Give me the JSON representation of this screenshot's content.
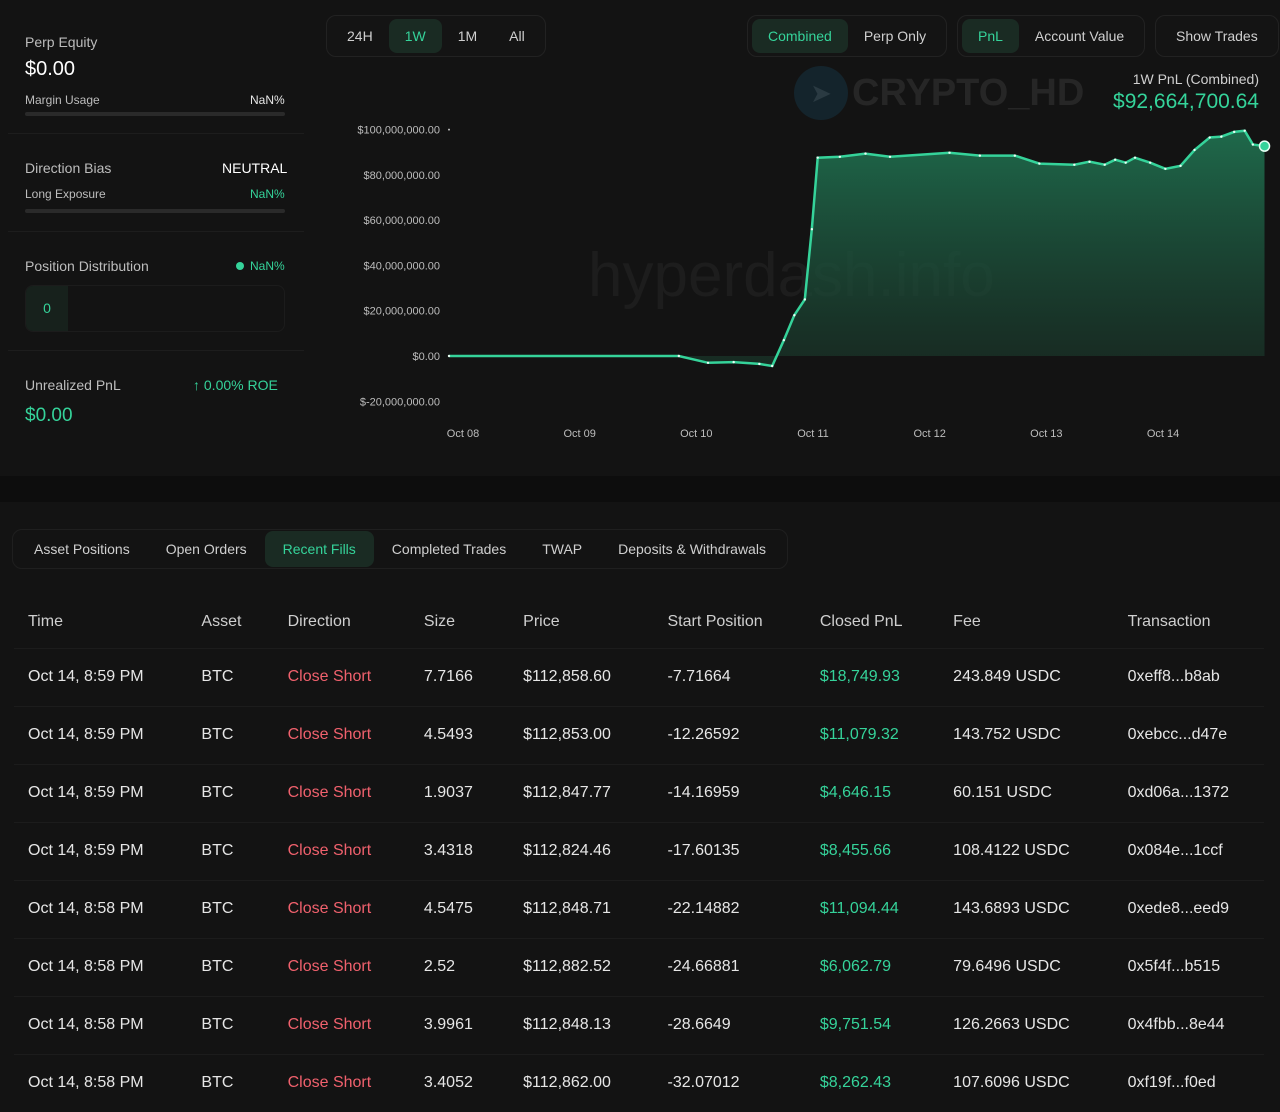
{
  "summary": {
    "perp_equity_label": "Perp Equity",
    "perp_equity": "$0.00",
    "margin_usage_label": "Margin Usage",
    "margin_usage": "NaN%",
    "direction_bias_label": "Direction Bias",
    "direction_bias": "NEUTRAL",
    "long_exposure_label": "Long Exposure",
    "long_exposure": "NaN%",
    "position_distribution_label": "Position Distribution",
    "position_distribution": "NaN%",
    "position_count": "0",
    "unrealized_pnl_label": "Unrealized PnL",
    "roe": "0.00% ROE",
    "unrealized_pnl": "$0.00"
  },
  "range_tabs": [
    "24H",
    "1W",
    "1M",
    "All"
  ],
  "mode_tabs": [
    "Combined",
    "Perp Only"
  ],
  "metric_tabs": [
    "PnL",
    "Account Value"
  ],
  "show_trades": "Show Trades",
  "watermark": "CRYPTO_HD",
  "watermark2": "hyperdash.info",
  "pnl_label": "1W PnL (Combined)",
  "pnl_value": "$92,664,700.64",
  "colors": {
    "accent": "#35d39a",
    "negative": "#f0616d"
  },
  "chart_data": {
    "type": "area",
    "yticks": [
      "$100,000,000.00",
      "$80,000,000.00",
      "$60,000,000.00",
      "$40,000,000.00",
      "$20,000,000.00",
      "$0.00",
      "$-20,000,000.00"
    ],
    "ytick_values": [
      100,
      80,
      60,
      40,
      20,
      0,
      -20
    ],
    "xticks": [
      "Oct 08",
      "Oct 09",
      "Oct 10",
      "Oct 11",
      "Oct 12",
      "Oct 13",
      "Oct 14"
    ],
    "ylim_millions": [
      -20,
      100
    ],
    "series_days_since_oct08_vs_pnl_millions": [
      [
        -0.12,
        0
      ],
      [
        1.85,
        0
      ],
      [
        2.1,
        -3
      ],
      [
        2.32,
        -2.7
      ],
      [
        2.54,
        -3.5
      ],
      [
        2.65,
        -4.4
      ],
      [
        2.75,
        7
      ],
      [
        2.84,
        18
      ],
      [
        2.93,
        25
      ],
      [
        2.99,
        56
      ],
      [
        3.04,
        87.6
      ],
      [
        3.23,
        88
      ],
      [
        3.45,
        89.4
      ],
      [
        3.66,
        88
      ],
      [
        4.17,
        89.8
      ],
      [
        4.43,
        88.5
      ],
      [
        4.73,
        88.5
      ],
      [
        4.94,
        85
      ],
      [
        5.24,
        84.5
      ],
      [
        5.37,
        85.8
      ],
      [
        5.5,
        84.5
      ],
      [
        5.59,
        86.7
      ],
      [
        5.68,
        85.4
      ],
      [
        5.76,
        87.6
      ],
      [
        5.89,
        85.4
      ],
      [
        6.02,
        82.7
      ],
      [
        6.15,
        84
      ],
      [
        6.27,
        91
      ],
      [
        6.4,
        96.5
      ],
      [
        6.5,
        96.9
      ],
      [
        6.61,
        99
      ],
      [
        6.7,
        99.5
      ],
      [
        6.77,
        93.4
      ],
      [
        6.87,
        92.7
      ]
    ]
  },
  "fill_tabs": [
    "Asset Positions",
    "Open Orders",
    "Recent Fills",
    "Completed Trades",
    "TWAP",
    "Deposits & Withdrawals"
  ],
  "table": {
    "headers": [
      "Time",
      "Asset",
      "Direction",
      "Size",
      "Price",
      "Start Position",
      "Closed PnL",
      "Fee",
      "Transaction"
    ],
    "rows": [
      [
        "Oct 14, 8:59 PM",
        "BTC",
        "Close Short",
        "7.7166",
        "$112,858.60",
        "-7.71664",
        "$18,749.93",
        "243.849 USDC",
        "0xeff8...b8ab"
      ],
      [
        "Oct 14, 8:59 PM",
        "BTC",
        "Close Short",
        "4.5493",
        "$112,853.00",
        "-12.26592",
        "$11,079.32",
        "143.752 USDC",
        "0xebcc...d47e"
      ],
      [
        "Oct 14, 8:59 PM",
        "BTC",
        "Close Short",
        "1.9037",
        "$112,847.77",
        "-14.16959",
        "$4,646.15",
        "60.151 USDC",
        "0xd06a...1372"
      ],
      [
        "Oct 14, 8:59 PM",
        "BTC",
        "Close Short",
        "3.4318",
        "$112,824.46",
        "-17.60135",
        "$8,455.66",
        "108.4122 USDC",
        "0x084e...1ccf"
      ],
      [
        "Oct 14, 8:58 PM",
        "BTC",
        "Close Short",
        "4.5475",
        "$112,848.71",
        "-22.14882",
        "$11,094.44",
        "143.6893 USDC",
        "0xede8...eed9"
      ],
      [
        "Oct 14, 8:58 PM",
        "BTC",
        "Close Short",
        "2.52",
        "$112,882.52",
        "-24.66881",
        "$6,062.79",
        "79.6496 USDC",
        "0x5f4f...b515"
      ],
      [
        "Oct 14, 8:58 PM",
        "BTC",
        "Close Short",
        "3.9961",
        "$112,848.13",
        "-28.6649",
        "$9,751.54",
        "126.2663 USDC",
        "0x4fbb...8e44"
      ],
      [
        "Oct 14, 8:58 PM",
        "BTC",
        "Close Short",
        "3.4052",
        "$112,862.00",
        "-32.07012",
        "$8,262.43",
        "107.6096 USDC",
        "0xf19f...f0ed"
      ]
    ]
  }
}
